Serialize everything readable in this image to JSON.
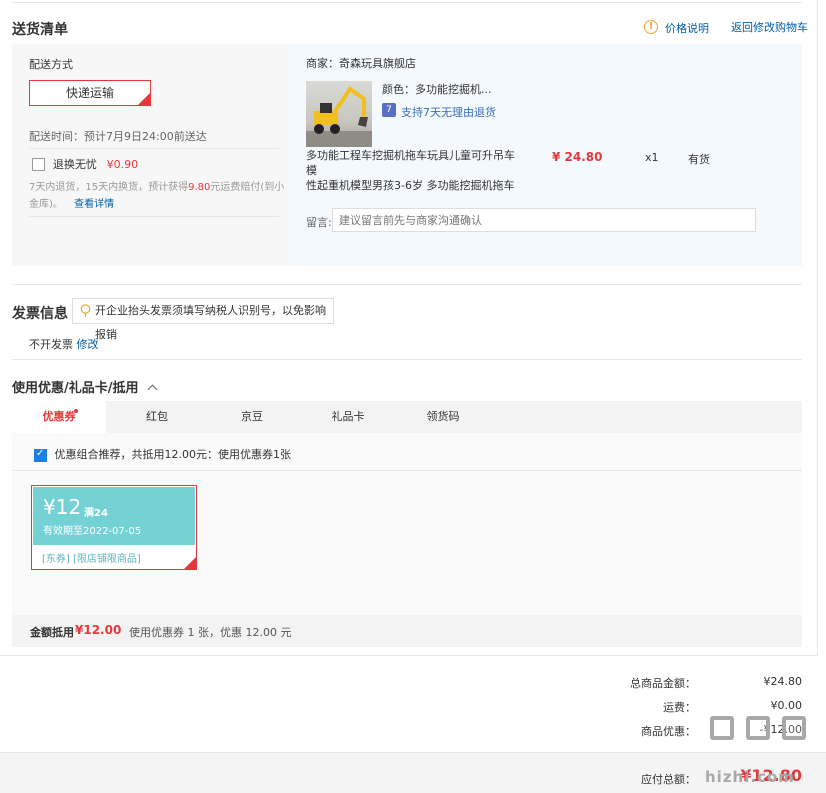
{
  "header": {
    "title": "送货清单",
    "price_note": "价格说明",
    "back_cart": "返回修改购物车"
  },
  "delivery": {
    "label": "配送方式",
    "method": "快递运输",
    "time": "配送时间：预计7月9日24:00前送达",
    "exchange_label": "退换无忧",
    "exchange_price": "¥0.90",
    "exchange_desc_1": "7天内退货，15天内换货，预计获得",
    "exchange_amount": "9.80",
    "exchange_desc_2": "元运费赔付(到小",
    "exchange_desc_3": "金库)。",
    "exchange_detail": "查看详情"
  },
  "shop": {
    "name": "商家：奇森玩具旗舰店",
    "color": "颜色：多功能挖掘机...",
    "return_badge": "7",
    "return_policy": "支持7天无理由退货",
    "product_line1": "多功能工程车挖掘机拖车玩具儿童可升吊车模",
    "product_line2": "性起重机模型男孩3-6岁 多功能挖掘机拖车",
    "price": "¥ 24.80",
    "qty": "x1",
    "stock": "有货",
    "memo_label": "留言:",
    "memo_placeholder": "建议留言前先与商家沟通确认"
  },
  "invoice": {
    "title": "发票信息",
    "hint": "开企业抬头发票须填写纳税人识别号，以免影响报销",
    "status": "不开发票",
    "edit": "修改"
  },
  "discount": {
    "title": "使用优惠/礼品卡/抵用",
    "tabs": [
      {
        "label": "优惠券"
      },
      {
        "label": "红包"
      },
      {
        "label": "京豆"
      },
      {
        "label": "礼品卡"
      },
      {
        "label": "领货码"
      }
    ],
    "combo_text": "优惠组合推荐，共抵用12.00元：使用优惠券1张",
    "coupon": {
      "amount": "¥12",
      "condition": "满24",
      "expiry": "有效期至2022-07-05",
      "tag1": "[东券]",
      "tag2": "[限店铺限商品]"
    },
    "summary_label": "金额抵用",
    "summary_amount": "¥12.00",
    "summary_detail": "使用优惠券 1 张，优惠 12.00 元"
  },
  "totals": {
    "goods_label": "总商品金额：",
    "goods_value": "¥24.80",
    "freight_label": "运费：",
    "freight_value": "¥0.00",
    "discount_label": "商品优惠：",
    "discount_value": "-¥12.00",
    "payable_label": "应付总额：",
    "payable_value": "¥12.80"
  },
  "watermark": {
    "text": "hizhi.com"
  },
  "colors": {
    "accent": "#e4393c",
    "link": "#005ea7",
    "coupon": "#74d2d5"
  }
}
